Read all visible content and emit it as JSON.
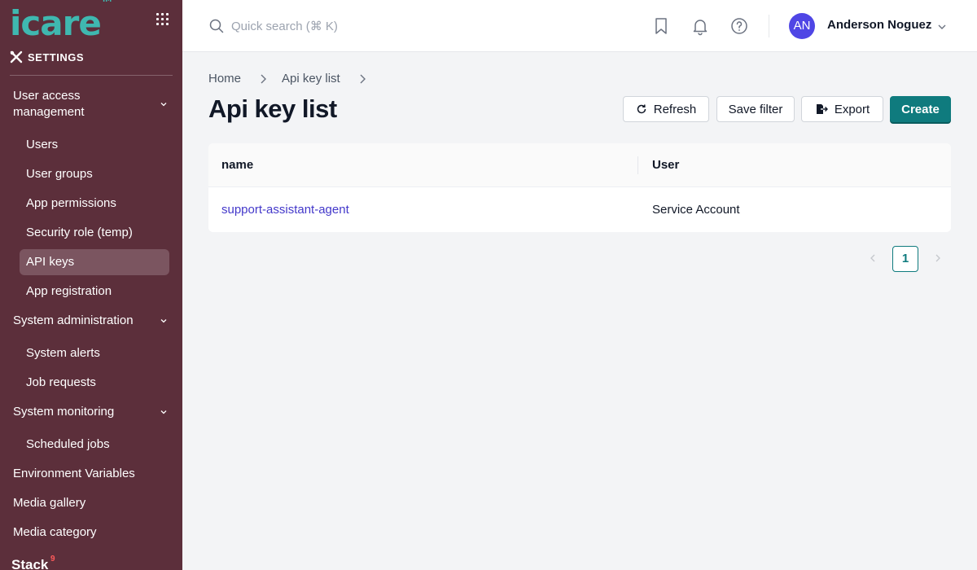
{
  "app": {
    "logo_text": "icare",
    "logo_mark": "TM"
  },
  "sidebar": {
    "section_title": "SETTINGS",
    "groups": [
      {
        "label": "User access management",
        "line1": "User access",
        "line2": "management"
      },
      {
        "label": "System administration"
      },
      {
        "label": "System monitoring"
      }
    ],
    "items_access": [
      {
        "label": "Users"
      },
      {
        "label": "User groups"
      },
      {
        "label": "App permissions"
      },
      {
        "label": "Security role (temp)"
      },
      {
        "label": "API keys",
        "active": true
      },
      {
        "label": "App registration"
      }
    ],
    "items_admin": [
      {
        "label": "System alerts"
      },
      {
        "label": "Job requests"
      }
    ],
    "items_monitoring": [
      {
        "label": "Scheduled jobs"
      }
    ],
    "top_items": [
      {
        "label": "Environment Variables"
      },
      {
        "label": "Media gallery"
      },
      {
        "label": "Media category"
      }
    ],
    "stack_label": "Stack",
    "stack_badge": "9"
  },
  "topbar": {
    "search_placeholder": "Quick search (⌘ K)",
    "avatar_initials": "AN",
    "user_name": "Anderson Noguez"
  },
  "breadcrumb": [
    {
      "label": "Home"
    },
    {
      "label": "Api key list"
    }
  ],
  "page": {
    "title": "Api key list",
    "buttons": {
      "refresh": "Refresh",
      "save_filter": "Save filter",
      "export": "Export",
      "create": "Create"
    }
  },
  "table": {
    "columns": [
      "name",
      "User"
    ],
    "rows": [
      {
        "name": "support-assistant-agent",
        "user": "Service Account"
      }
    ]
  },
  "pagination": {
    "current_page": "1"
  },
  "colors": {
    "sidebar_bg": "#5c2f3b",
    "accent": "#0f7b7e",
    "logo": "#3fb8b0",
    "link": "#4338ca",
    "avatar": "#4f46e5"
  }
}
